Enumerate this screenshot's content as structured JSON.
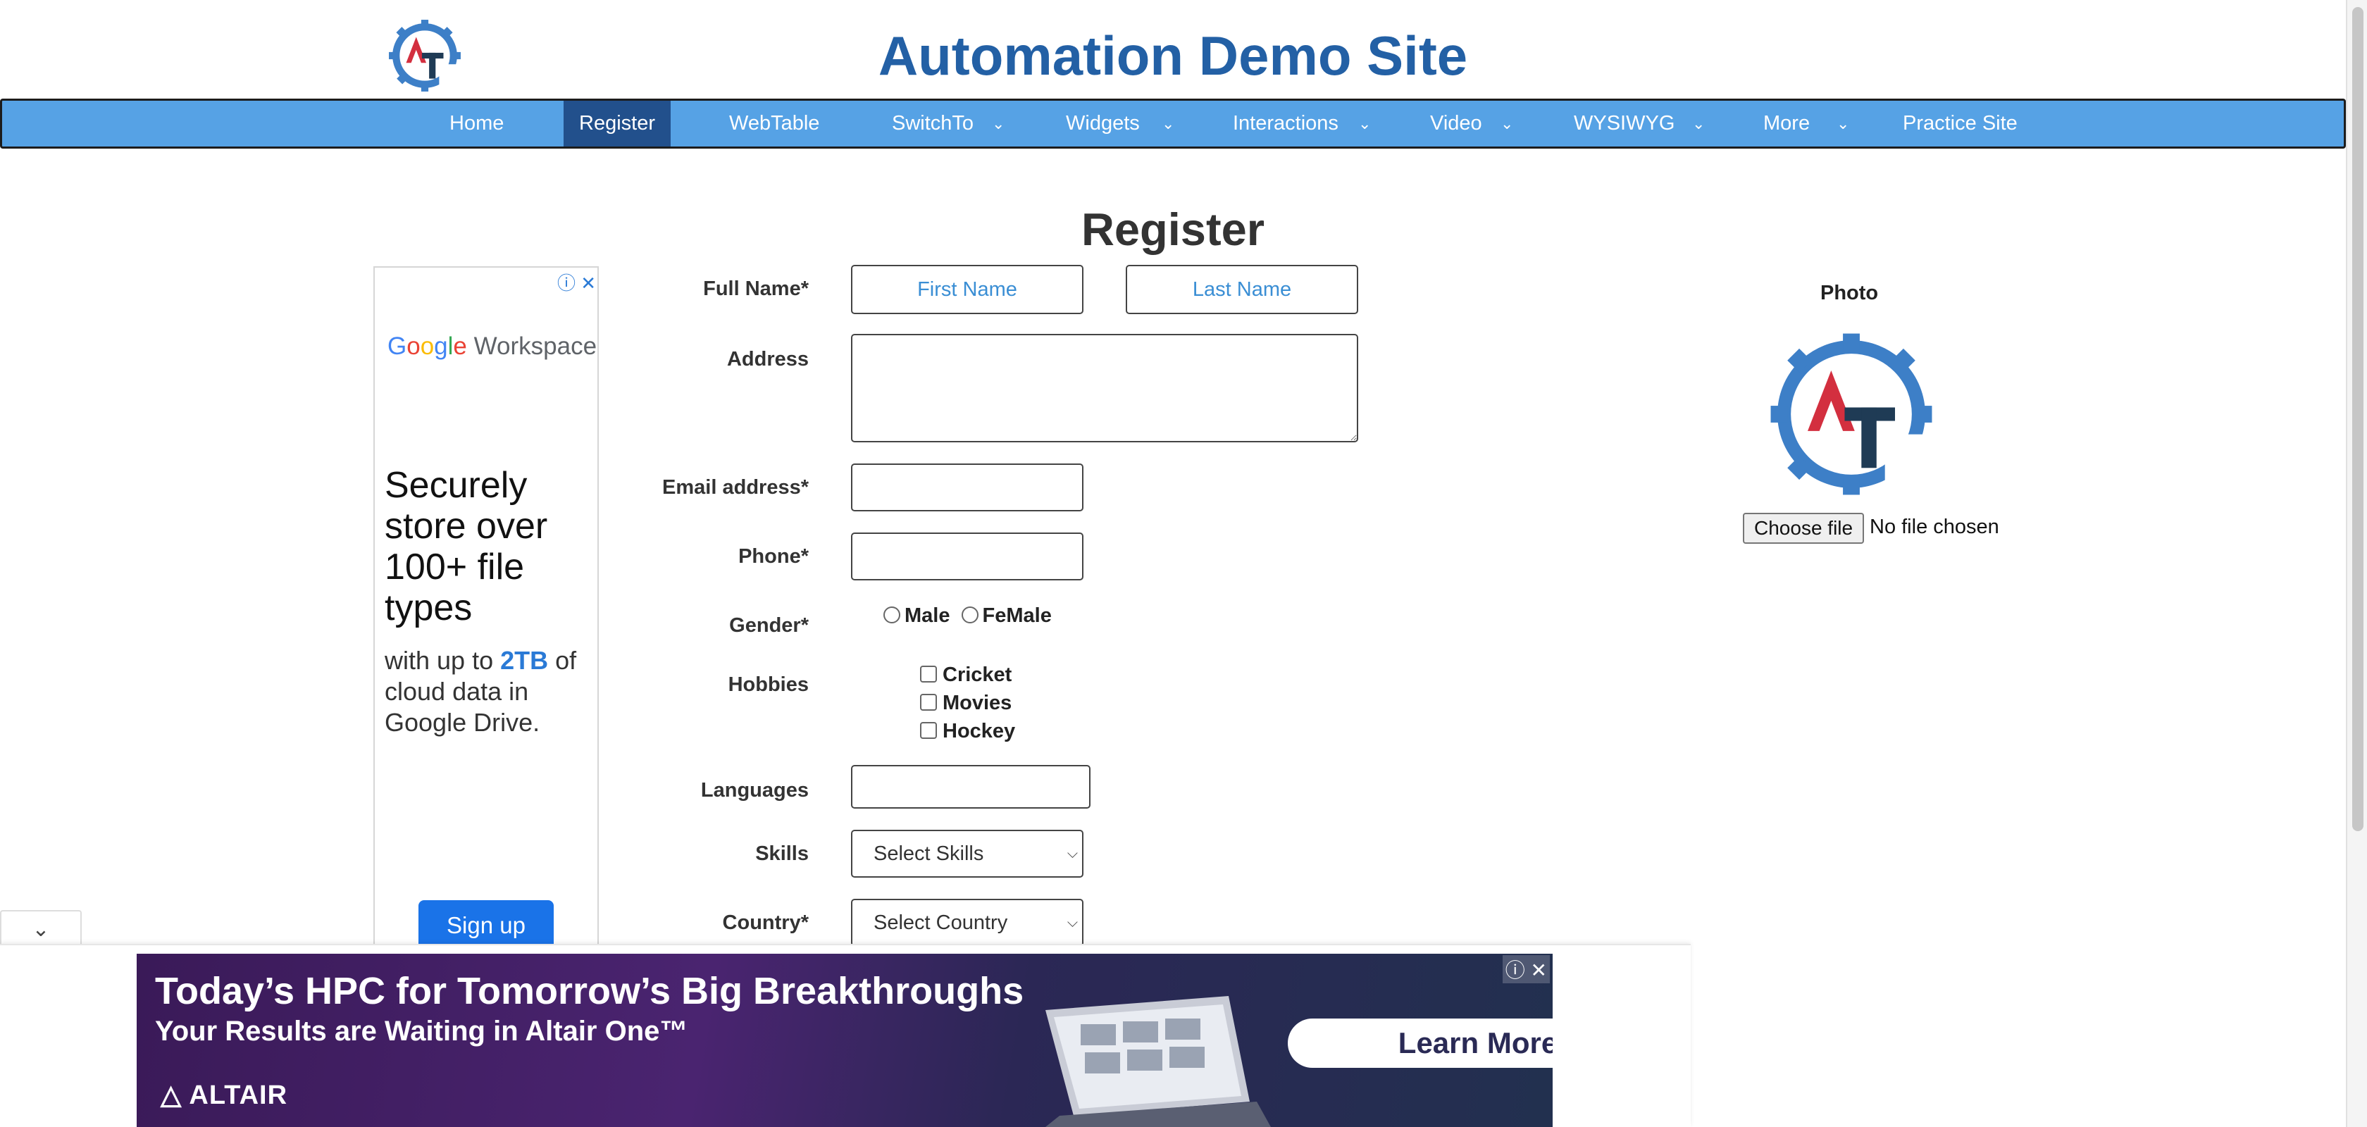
{
  "header": {
    "title": "Automation Demo Site",
    "logo_letters": "AT"
  },
  "nav": {
    "items": [
      {
        "label": "Home",
        "dropdown": false,
        "active": false
      },
      {
        "label": "Register",
        "dropdown": false,
        "active": true
      },
      {
        "label": "WebTable",
        "dropdown": false,
        "active": false
      },
      {
        "label": "SwitchTo",
        "dropdown": true,
        "active": false
      },
      {
        "label": "Widgets",
        "dropdown": true,
        "active": false
      },
      {
        "label": "Interactions",
        "dropdown": true,
        "active": false
      },
      {
        "label": "Video",
        "dropdown": true,
        "active": false
      },
      {
        "label": "WYSIWYG",
        "dropdown": true,
        "active": false
      },
      {
        "label": "More",
        "dropdown": true,
        "active": false
      },
      {
        "label": "Practice Site",
        "dropdown": false,
        "active": false
      }
    ],
    "chevron": "⌄"
  },
  "page": {
    "heading": "Register"
  },
  "form": {
    "full_name_label": "Full Name*",
    "first_name_placeholder": "First Name",
    "last_name_placeholder": "Last Name",
    "address_label": "Address",
    "address_value": "",
    "email_label": "Email address*",
    "email_value": "",
    "phone_label": "Phone*",
    "phone_value": "",
    "gender_label": "Gender*",
    "gender_options": [
      "Male",
      "FeMale"
    ],
    "hobbies_label": "Hobbies",
    "hobbies": [
      "Cricket",
      "Movies",
      "Hockey"
    ],
    "languages_label": "Languages",
    "skills_label": "Skills",
    "skills_selected": "Select Skills",
    "country_label": "Country*",
    "country_selected": "Select Country"
  },
  "photo": {
    "label": "Photo",
    "choose_file_label": "Choose file",
    "file_status": "No file chosen"
  },
  "side_ad": {
    "brand_google": "Google",
    "brand_product": "Workspace",
    "headline": "Securely store over 100+ file types",
    "sub_prefix": "with up to ",
    "sub_highlight": "2TB",
    "sub_suffix": " of cloud data in Google Drive.",
    "cta": "Sign up",
    "close": "ⓘ ✕"
  },
  "bottom_ad": {
    "headline": "Today’s HPC for Tomorrow’s Big Breakthroughs",
    "subline": "Your Results are Waiting in Altair One™",
    "brand": "ALTAIR",
    "cta": "Learn More",
    "close": "ⓘ ✕",
    "toggle": "⌄"
  },
  "colors": {
    "nav_bg": "#56a2e5",
    "nav_active": "#22508c",
    "title": "#2360a5",
    "placeholder": "#3a8ed4",
    "ad_button": "#1a73e8"
  }
}
